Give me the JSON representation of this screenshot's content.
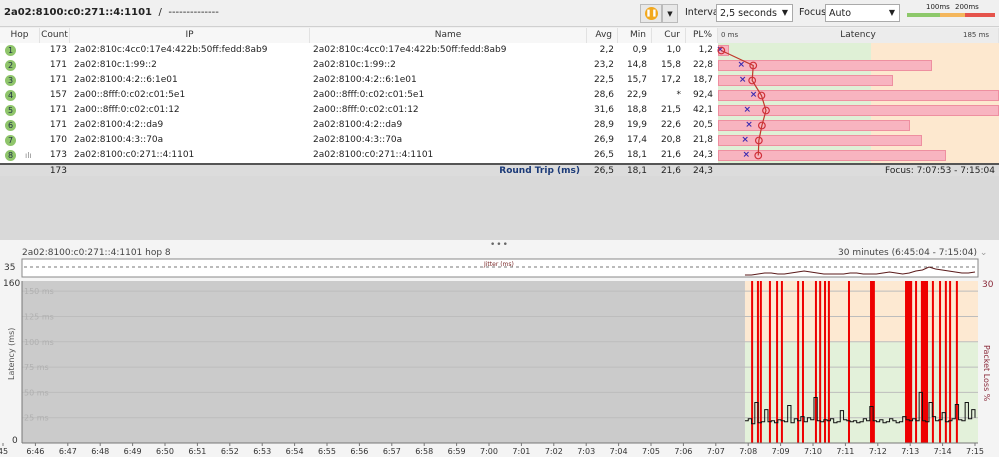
{
  "header": {
    "target": "2a02:8100:c0:271::4:1101",
    "separator": "/",
    "subtitle": "--------------",
    "interval_label": "Interval",
    "interval_value": "2,5 seconds",
    "focus_label": "Focus",
    "focus_value": "Auto",
    "legend_100": "100ms",
    "legend_200": "200ms"
  },
  "colors": {
    "good": "#8dc86a",
    "warn": "#f4b65c",
    "bad": "#e5534b",
    "loss": "#ee0000",
    "pause": "#f2a81d"
  },
  "table": {
    "columns": [
      "Hop",
      "Count",
      "IP",
      "Name",
      "Avg",
      "Min",
      "Cur",
      "PL%",
      "Latency"
    ],
    "latency_min_label": "0 ms",
    "latency_max_label": "185 ms",
    "latency_max": 185,
    "pl_scale_max": 30,
    "rows": [
      {
        "hop": "1",
        "count": "173",
        "ip": "2a02:810c:4cc0:17e4:422b:50ff:fedd:8ab9",
        "name": "2a02:810c:4cc0:17e4:422b:50ff:fedd:8ab9",
        "avg": "2,2",
        "min": "0,9",
        "cur": "1,0",
        "pl": "1,2"
      },
      {
        "hop": "2",
        "count": "171",
        "ip": "2a02:810c:1:99::2",
        "name": "2a02:810c:1:99::2",
        "avg": "23,2",
        "min": "14,8",
        "cur": "15,8",
        "pl": "22,8"
      },
      {
        "hop": "3",
        "count": "171",
        "ip": "2a02:8100:4:2::6:1e01",
        "name": "2a02:8100:4:2::6:1e01",
        "avg": "22,5",
        "min": "15,7",
        "cur": "17,2",
        "pl": "18,7"
      },
      {
        "hop": "4",
        "count": "157",
        "ip": "2a00::8fff:0:c02:c01:5e1",
        "name": "2a00::8fff:0:c02:c01:5e1",
        "avg": "28,6",
        "min": "22,9",
        "cur": "*",
        "pl": "92,4"
      },
      {
        "hop": "5",
        "count": "171",
        "ip": "2a00::8fff:0:c02:c01:12",
        "name": "2a00::8fff:0:c02:c01:12",
        "avg": "31,6",
        "min": "18,8",
        "cur": "21,5",
        "pl": "42,1"
      },
      {
        "hop": "6",
        "count": "171",
        "ip": "2a02:8100:4:2::da9",
        "name": "2a02:8100:4:2::da9",
        "avg": "28,9",
        "min": "19,9",
        "cur": "22,6",
        "pl": "20,5"
      },
      {
        "hop": "7",
        "count": "170",
        "ip": "2a02:8100:4:3::70a",
        "name": "2a02:8100:4:3::70a",
        "avg": "26,9",
        "min": "17,4",
        "cur": "20,8",
        "pl": "21,8"
      },
      {
        "hop": "8",
        "count": "173",
        "ip": "2a02:8100:c0:271::4:1101",
        "name": "2a02:8100:c0:271::4:1101",
        "avg": "26,5",
        "min": "18,1",
        "cur": "21,6",
        "pl": "24,3"
      }
    ],
    "summary": {
      "count": "173",
      "label": "Round Trip (ms)",
      "avg": "26,5",
      "min": "18,1",
      "cur": "21,6",
      "pl": "24,3",
      "focus": "Focus: 7:07:53 - 7:15:04"
    }
  },
  "graph": {
    "title": "2a02:8100:c0:271::4:1101 hop 8",
    "range": "30 minutes (6:45:04 - 7:15:04)",
    "jitter_label": "Jitter (ms)",
    "jitter_max": "35",
    "chart_data": {
      "type": "line",
      "ylabel": "Latency (ms)",
      "y2label": "Packet Loss %",
      "ylim": [
        0,
        160
      ],
      "y2max": "30",
      "ymin_label": "0",
      "ymax_label": "160",
      "grid_labels": [
        "150 ms",
        "125 ms",
        "100 ms",
        "75 ms",
        "50 ms",
        "25 ms"
      ],
      "grid_values": [
        150,
        125,
        100,
        75,
        50,
        25
      ],
      "x_ticks": [
        "45",
        "6:46",
        "6:47",
        "6:48",
        "6:49",
        "6:50",
        "6:51",
        "6:52",
        "6:53",
        "6:54",
        "6:55",
        "6:56",
        "6:57",
        "6:58",
        "6:59",
        "7:00",
        "7:01",
        "7:02",
        "7:03",
        "7:04",
        "7:05",
        "7:06",
        "7:07",
        "7:08",
        "7:09",
        "7:10",
        "7:11",
        "7:12",
        "7:13",
        "7:14",
        "7:15"
      ],
      "data_start_min": 22.9,
      "data_end_min": 30,
      "latency": [
        22,
        24,
        19,
        40,
        20,
        21,
        33,
        21,
        22,
        20,
        23,
        22,
        21,
        37,
        20,
        24,
        22,
        26,
        21,
        25,
        23,
        45,
        22,
        21,
        23,
        22,
        24,
        20,
        21,
        32,
        23,
        22,
        21,
        22,
        20,
        21,
        24,
        22,
        36,
        22,
        21,
        23,
        20,
        21,
        24,
        22,
        20,
        21,
        26,
        23,
        22,
        24,
        22,
        50,
        22,
        21,
        40,
        26,
        22,
        23,
        30,
        21,
        22,
        24,
        38,
        23,
        22,
        40,
        24,
        33,
        25
      ],
      "jitter": [
        1,
        1,
        2,
        3,
        3,
        2,
        2,
        3,
        4,
        5,
        4,
        3,
        2,
        2,
        2,
        2,
        3,
        3,
        2,
        2,
        2,
        3,
        4,
        3,
        2,
        3,
        5,
        6,
        9,
        7,
        6,
        5,
        4,
        3,
        3,
        4
      ],
      "loss_events": [
        [
          23.09,
          0.06
        ],
        [
          23.27,
          0.06
        ],
        [
          23.36,
          0.06
        ],
        [
          23.64,
          0.06
        ],
        [
          23.86,
          0.06
        ],
        [
          24.01,
          0.06
        ],
        [
          24.51,
          0.06
        ],
        [
          24.66,
          0.06
        ],
        [
          25.06,
          0.06
        ],
        [
          25.19,
          0.06
        ],
        [
          25.34,
          0.06
        ],
        [
          25.46,
          0.06
        ],
        [
          26.08,
          0.04
        ],
        [
          26.76,
          0.15
        ],
        [
          27.84,
          0.22
        ],
        [
          28.15,
          0.06
        ],
        [
          28.33,
          0.22
        ],
        [
          28.67,
          0.06
        ],
        [
          28.89,
          0.06
        ],
        [
          29.07,
          0.06
        ],
        [
          29.2,
          0.06
        ],
        [
          29.41,
          0.06
        ]
      ]
    }
  }
}
